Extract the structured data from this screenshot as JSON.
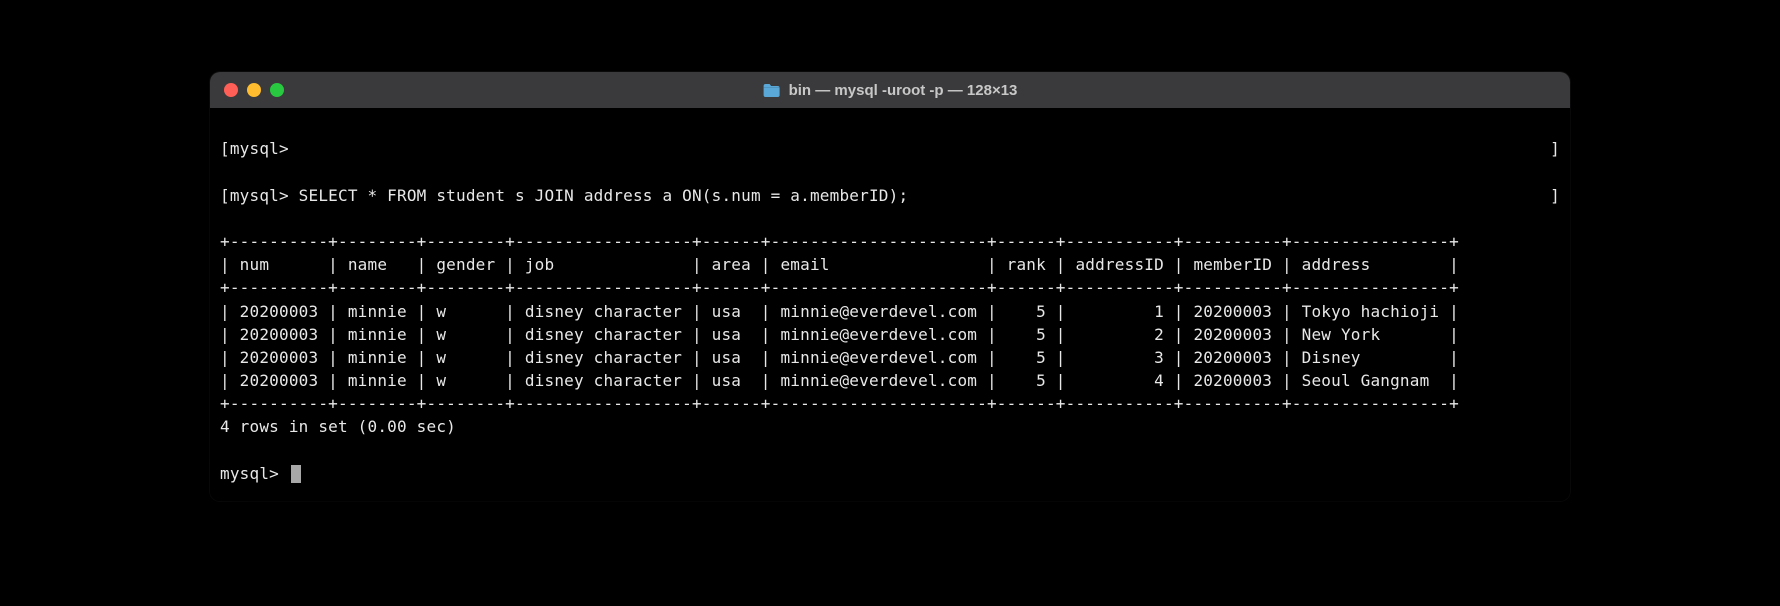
{
  "window": {
    "title": "bin — mysql -uroot -p — 128×13"
  },
  "prompt": "mysql>",
  "lines": {
    "l0": "[mysql>",
    "l0_close": "]",
    "l1": "[mysql> SELECT * FROM student s JOIN address a ON(s.num = a.memberID);",
    "l1_close": "]"
  },
  "table": {
    "border": "+----------+--------+--------+------------------+------+----------------------+------+-----------+----------+----------------+",
    "header": "| num      | name   | gender | job              | area | email                | rank | addressID | memberID | address        |",
    "rows": [
      "| 20200003 | minnie | w      | disney character | usa  | minnie@everdevel.com |    5 |         1 | 20200003 | Tokyo hachioji |",
      "| 20200003 | minnie | w      | disney character | usa  | minnie@everdevel.com |    5 |         2 | 20200003 | New York       |",
      "| 20200003 | minnie | w      | disney character | usa  | minnie@everdevel.com |    5 |         3 | 20200003 | Disney         |",
      "| 20200003 | minnie | w      | disney character | usa  | minnie@everdevel.com |    5 |         4 | 20200003 | Seoul Gangnam  |"
    ]
  },
  "summary": "4 rows in set (0.00 sec)",
  "final_prompt": "mysql> "
}
